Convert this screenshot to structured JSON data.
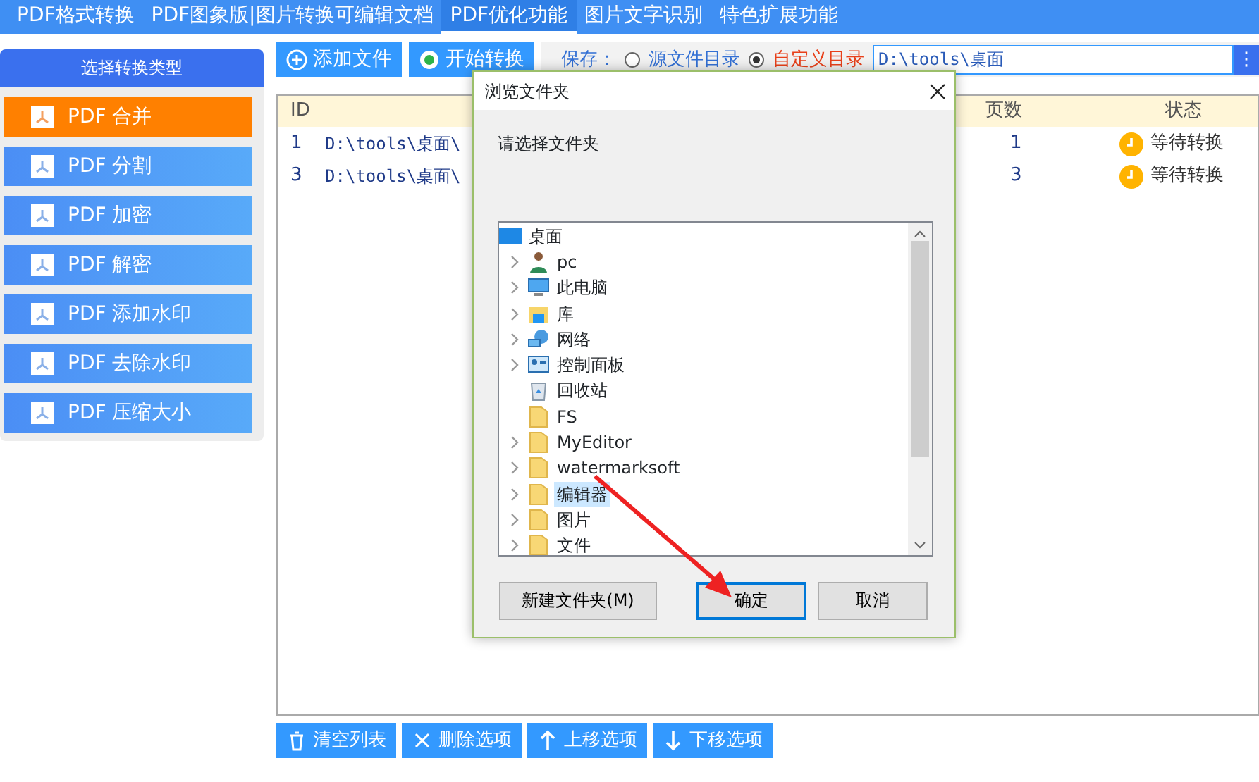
{
  "top_tabs": [
    {
      "label": "PDF格式转换",
      "selected": false
    },
    {
      "label": "PDF图象版|图片转换可编辑文档",
      "selected": false
    },
    {
      "label": "PDF优化功能",
      "selected": true
    },
    {
      "label": "图片文字识别",
      "selected": false
    },
    {
      "label": "特色扩展功能",
      "selected": false
    }
  ],
  "sidebar": {
    "title": "选择转换类型",
    "items": [
      {
        "label": "PDF 合并",
        "selected": true
      },
      {
        "label": "PDF 分割",
        "selected": false
      },
      {
        "label": "PDF 加密",
        "selected": false
      },
      {
        "label": "PDF 解密",
        "selected": false
      },
      {
        "label": "PDF 添加水印",
        "selected": false
      },
      {
        "label": "PDF 去除水印",
        "selected": false
      },
      {
        "label": "PDF 压缩大小",
        "selected": false
      }
    ]
  },
  "toolbar": {
    "add_button": "添加文件",
    "start_button": "开始转换",
    "save_label": "保存：",
    "save_options": [
      {
        "label": "源文件目录",
        "selected": false
      },
      {
        "label": "自定义目录",
        "selected": true
      }
    ],
    "path": "D:\\tools\\桌面",
    "browse_button": "⋮"
  },
  "table": {
    "columns": [
      "ID",
      "页数",
      "状态"
    ],
    "rows": [
      {
        "id": "1",
        "path": "D:\\tools\\桌面\\",
        "pages": "1",
        "status": "等待转换"
      },
      {
        "id": "3",
        "path": "D:\\tools\\桌面\\",
        "pages": "3",
        "status": "等待转换"
      }
    ]
  },
  "bottom_buttons": [
    {
      "kind": "clear",
      "label": "清空列表"
    },
    {
      "kind": "delete",
      "label": "删除选项"
    },
    {
      "kind": "up",
      "label": "上移选项"
    },
    {
      "kind": "down",
      "label": "下移选项"
    }
  ],
  "dialog": {
    "title": "浏览文件夹",
    "prompt": "请选择文件夹",
    "tree": [
      {
        "label": "桌面",
        "kind": "desktop",
        "expandable": false,
        "selected": false,
        "children": [
          {
            "label": "pc",
            "kind": "user",
            "expandable": true,
            "selected": false
          },
          {
            "label": "此电脑",
            "kind": "computer",
            "expandable": true,
            "selected": false
          },
          {
            "label": "库",
            "kind": "library",
            "expandable": true,
            "selected": false
          },
          {
            "label": "网络",
            "kind": "network",
            "expandable": true,
            "selected": false
          },
          {
            "label": "控制面板",
            "kind": "control-panel",
            "expandable": true,
            "selected": false
          },
          {
            "label": "回收站",
            "kind": "recycle-bin",
            "expandable": false,
            "selected": false
          },
          {
            "label": "FS",
            "kind": "folder",
            "expandable": false,
            "selected": false
          },
          {
            "label": "MyEditor",
            "kind": "folder",
            "expandable": true,
            "selected": false
          },
          {
            "label": "watermarksoft",
            "kind": "folder",
            "expandable": true,
            "selected": false
          },
          {
            "label": "编辑器",
            "kind": "folder",
            "expandable": true,
            "selected": true
          },
          {
            "label": "图片",
            "kind": "folder",
            "expandable": true,
            "selected": false
          },
          {
            "label": "文件",
            "kind": "folder",
            "expandable": true,
            "selected": false
          }
        ]
      }
    ],
    "buttons": [
      {
        "label": "新建文件夹(M)",
        "selected": false
      },
      {
        "label": "确定",
        "selected": true
      },
      {
        "label": "取消",
        "selected": false
      }
    ]
  }
}
